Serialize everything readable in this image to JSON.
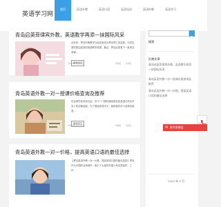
{
  "site": {
    "logo": "英语学习网"
  },
  "nav": [
    {
      "label": "首页",
      "active": true
    },
    {
      "label": "英语外教",
      "active": false
    },
    {
      "label": "英语口语",
      "active": false
    },
    {
      "label": "英语培训",
      "active": false
    },
    {
      "label": "英语外教",
      "active": false
    },
    {
      "label": "英语学习",
      "active": false
    }
  ],
  "articles": [
    {
      "title": "青岛启英菲律宾外教，英语教学再添一抹国际风采",
      "excerpt": "近年来，青岛外教教学已经逐渐成为青岛同仁的选拔。为学生提供更加高效的英语教学资源。最近，青岛启英签下一批来自菲律...",
      "read_more": "阅读全文",
      "date": "2024年5月20日",
      "views": "0浏览",
      "comments": "0评论"
    },
    {
      "title": "青岛英语外教一对一授课价格查询及推荐",
      "excerpt": "在全球的全球化社会，学习一门国际通用语言如英语已成为许多人的必备技能。为了提高英语水平，越来越多的人选择找英语...",
      "read_more": "阅读全文",
      "date": "2024年5月20日",
      "views": "0浏览",
      "comments": "0评论"
    },
    {
      "title": "青岛英语外教一对一价格，提高英语口语的最佳选择",
      "excerpt": "【青岛英语外教一对一价格，提高英语口语的最佳选择】青岛作为中国的沿海城市，吸引了大量的外国人来这里留学、工作...",
      "read_more": "",
      "date": "",
      "views": "",
      "comments": ""
    }
  ],
  "sidebar": {
    "search_placeholder": "",
    "search_icon": "search-icon",
    "heading_search": "搜索",
    "latest_heading": "近期文章",
    "latest": [
      "青岛启英菲律宾外教，英语教学再添一抹国际风采",
      "青岛英语外教一对一授课价格查询及推荐",
      "青岛英语外教一对一价格，提高英语口语的最佳选择"
    ],
    "archive_date": "2024 年 5 月"
  },
  "float_tag": {
    "label": "网专家微信",
    "icon": "chat-icon"
  },
  "colors": {
    "accent": "#3aa0e8",
    "float": "#e64240"
  }
}
